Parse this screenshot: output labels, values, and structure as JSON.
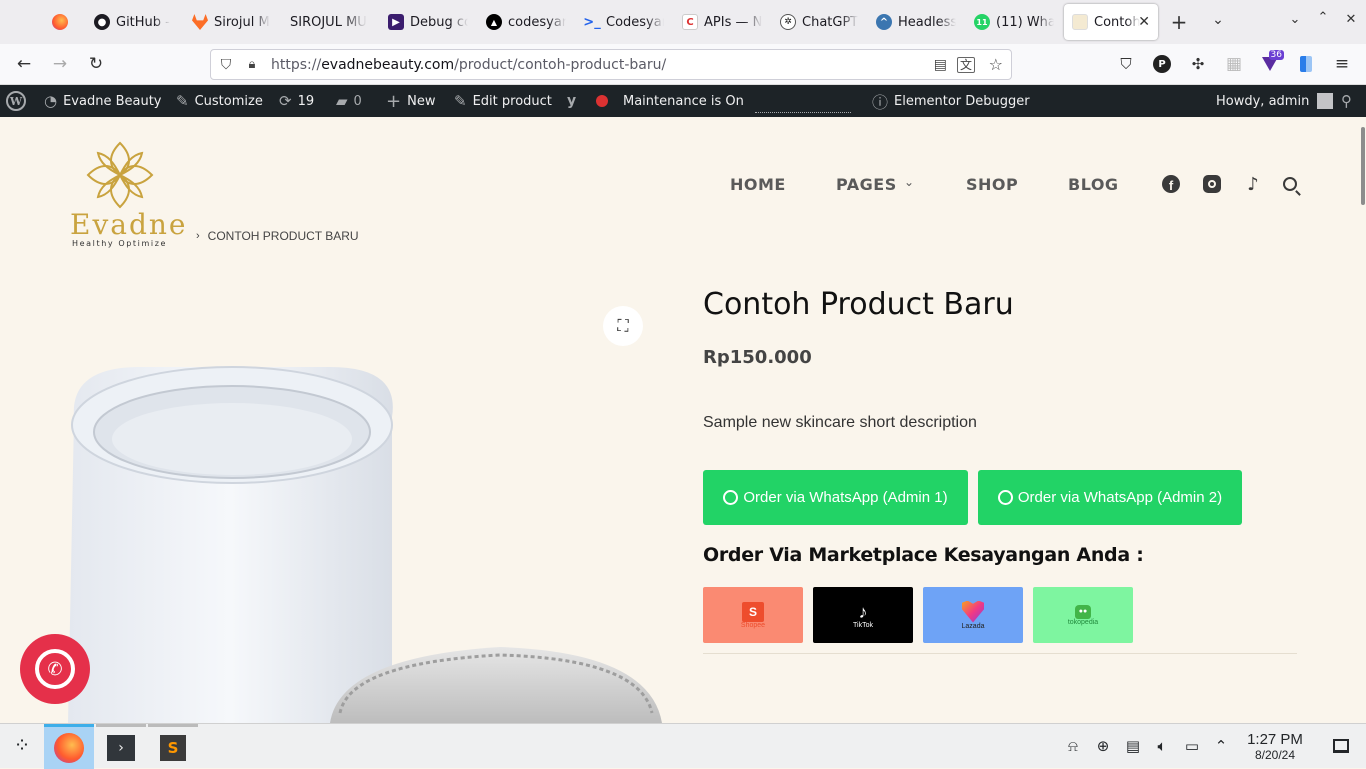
{
  "browser": {
    "tabs": [
      {
        "title": "",
        "icon": "firefox-icon"
      },
      {
        "title": "GitHub -",
        "icon": "github-icon"
      },
      {
        "title": "Sirojul M",
        "icon": "gitlab-icon"
      },
      {
        "title": "SIROJUL MU",
        "icon": "none"
      },
      {
        "title": "Debug co",
        "icon": "debug-icon"
      },
      {
        "title": "codesyar",
        "icon": "triangle-icon"
      },
      {
        "title": "Codesyar",
        "icon": "codesyar-icon"
      },
      {
        "title": "APIs — N",
        "icon": "apis-icon"
      },
      {
        "title": "ChatGPT",
        "icon": "chatgpt-icon"
      },
      {
        "title": "Headless",
        "icon": "headless-icon"
      },
      {
        "title": "(11) Wha",
        "icon": "whatsapp-icon"
      },
      {
        "title": "Contoh",
        "icon": "page-icon",
        "active": true
      }
    ],
    "badge_11": "11",
    "url": {
      "scheme": "https://",
      "host": "evadnebeauty.com",
      "path": "/product/contoh-product-baru/"
    },
    "extension_badge": "36"
  },
  "adminbar": {
    "site_name": "Evadne Beauty",
    "customize": "Customize",
    "updates": "19",
    "comments": "0",
    "new": "New",
    "edit_product": "Edit product",
    "maintenance": "Maintenance is On",
    "debugger": "Elementor Debugger",
    "howdy": "Howdy, admin"
  },
  "site": {
    "logo_text": "Evadne",
    "logo_tagline": "Healthy Optimize",
    "nav": {
      "home": "HOME",
      "pages": "PAGES",
      "shop": "SHOP",
      "blog": "BLOG"
    },
    "breadcrumb": "CONTOH PRODUCT BARU",
    "product": {
      "title": "Contoh Product Baru",
      "price": "Rp150.000",
      "description": "Sample new skincare short description",
      "wa_button_1": "Order via WhatsApp (Admin 1)",
      "wa_button_2": "Order via WhatsApp (Admin 2)",
      "marketplace_heading": "Order Via Marketplace Kesayangan Anda :",
      "marketplaces": [
        {
          "name": "Shopee",
          "color": "#fa8a72"
        },
        {
          "name": "TikTok",
          "color": "#000000"
        },
        {
          "name": "Lazada",
          "color": "#6ea3f6"
        },
        {
          "name": "tokopedia",
          "color": "#7ef5a0"
        }
      ]
    }
  },
  "colors": {
    "whatsapp": "#22d366",
    "adminbar": "#1d2327",
    "page_bg": "#faf5ec",
    "logo_gold": "#c9a33f",
    "wa_float": "#e5304a"
  },
  "taskbar": {
    "time": "1:27 PM",
    "date": "8/20/24"
  }
}
